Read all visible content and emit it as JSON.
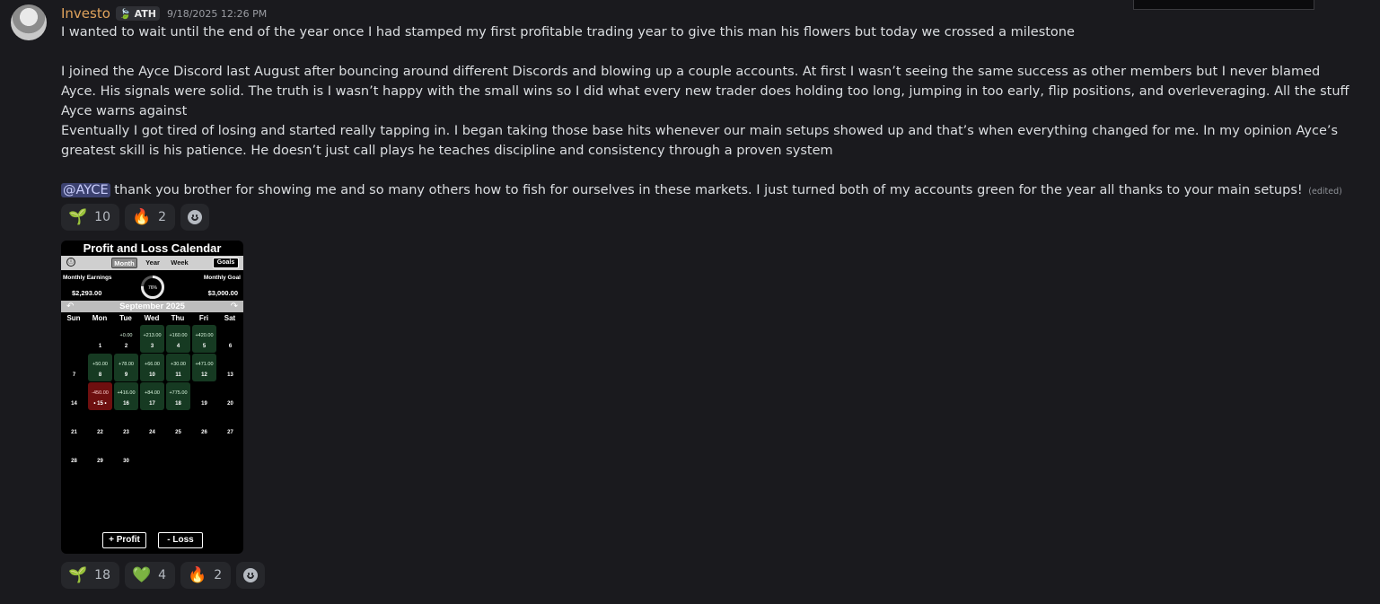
{
  "message": {
    "username": "Investo",
    "role": "ATH",
    "timestamp": "9/18/2025 12:26 PM",
    "paragraphs": [
      "I wanted to wait until the end of the year once I had stamped my first profitable trading year to give this man his flowers but today we crossed a milestone",
      "I joined the Ayce Discord last August after bouncing around different Discords and blowing up a couple accounts. At first I wasn’t seeing the same success as other members but I never blamed Ayce. His signals were solid. The truth is I wasn’t happy with the small wins so I did what every new trader does holding too long, jumping in too early, flip positions, and overleveraging. All the stuff Ayce warns against",
      "Eventually I got tired of losing and started really tapping in. I began taking those base hits whenever our main setups showed up and that’s when everything changed for me. In my opinion Ayce’s greatest skill is his patience. He doesn’t just call plays he teaches discipline and consistency through a proven system"
    ],
    "mention": "@AYCE",
    "last_text": "thank you brother for showing me and so many others how to fish for ourselves in these markets. I just turned both of my accounts green for the year all thanks to your main setups!",
    "edited": "(edited)"
  },
  "reactions_1": [
    {
      "emoji": "🌱",
      "icon": "seedling-icon",
      "count": "10"
    },
    {
      "emoji": "🔥",
      "icon": "fire-icon",
      "count": "2"
    }
  ],
  "reactions_2": [
    {
      "emoji": "🌱",
      "icon": "seedling-icon",
      "count": "18"
    },
    {
      "emoji": "💚",
      "icon": "green-heart-icon",
      "count": "4"
    },
    {
      "emoji": "🔥",
      "icon": "fire-icon",
      "count": "2"
    }
  ],
  "calendar": {
    "title": "Profit and Loss Calendar",
    "tabs": [
      "Month",
      "Year",
      "Week"
    ],
    "goals_label": "Goals",
    "info_glyph": "ⓘ",
    "earnings_label": "Monthly Earnings",
    "earnings_value": "$2,293.00",
    "goal_label": "Monthly Goal",
    "goal_value": "$3,000.00",
    "progress_label": "76%",
    "progress": 0.76,
    "month": "September 2025",
    "weekdays": [
      "Sun",
      "Mon",
      "Tue",
      "Wed",
      "Thu",
      "Fri",
      "Sat"
    ],
    "first_weekday": 1,
    "days_in_month": 30,
    "entries": {
      "2": {
        "amount": "+0.00",
        "kind": "none"
      },
      "3": {
        "amount": "+213.00",
        "kind": "profit"
      },
      "4": {
        "amount": "+160.00",
        "kind": "profit"
      },
      "5": {
        "amount": "+420.00",
        "kind": "profit"
      },
      "8": {
        "amount": "+50.00",
        "kind": "profit"
      },
      "9": {
        "amount": "+78.00",
        "kind": "profit"
      },
      "10": {
        "amount": "+66.00",
        "kind": "profit"
      },
      "11": {
        "amount": "+30.00",
        "kind": "profit"
      },
      "12": {
        "amount": "+471.00",
        "kind": "profit"
      },
      "15": {
        "amount": "-450.00",
        "kind": "loss",
        "day_label": "• 15 •"
      },
      "16": {
        "amount": "+416.00",
        "kind": "profit"
      },
      "17": {
        "amount": "+84.00",
        "kind": "profit"
      },
      "18": {
        "amount": "+775.00",
        "kind": "profit"
      }
    },
    "profit_button": "+ Profit",
    "loss_button": "- Loss"
  }
}
